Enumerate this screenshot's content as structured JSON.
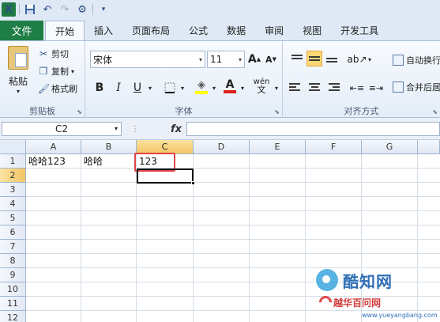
{
  "quick_access": {
    "icons": [
      "excel-app-icon",
      "save-icon",
      "undo-icon",
      "redo-icon",
      "customize-icon"
    ],
    "app_letter": "X"
  },
  "tabs": {
    "file": "文件",
    "items": [
      "开始",
      "插入",
      "页面布局",
      "公式",
      "数据",
      "审阅",
      "视图",
      "开发工具"
    ],
    "active": "开始"
  },
  "ribbon": {
    "clipboard": {
      "label": "剪贴板",
      "paste": "粘贴",
      "cut": "剪切",
      "copy": "复制",
      "format_painter": "格式刷"
    },
    "font": {
      "label": "字体",
      "font_name": "宋体",
      "font_size": "11",
      "grow": "A",
      "shrink": "A",
      "bold": "B",
      "italic": "I",
      "underline": "U",
      "font_color_letter": "A",
      "phonetic": "wén",
      "fill_color": "#ffff00",
      "font_color": "#e0201b"
    },
    "alignment": {
      "label": "对齐方式",
      "wrap_text": "自动换行",
      "merge_center": "合并后居"
    }
  },
  "formula_bar": {
    "name_box": "C2",
    "fx": "fx",
    "dots": "⋮",
    "value": ""
  },
  "sheet": {
    "columns": [
      "A",
      "B",
      "C",
      "D",
      "E",
      "F",
      "G"
    ],
    "rows": [
      "1",
      "2",
      "3",
      "4",
      "5",
      "6",
      "7",
      "8",
      "9",
      "10",
      "11",
      "12"
    ],
    "selected_column": "C",
    "selected_row": "2",
    "cells": {
      "A1": "哈哈123",
      "B1": "哈哈",
      "C1": "123"
    }
  },
  "watermark": {
    "title": "酷知网",
    "subtitle": "越华百问网",
    "url": "www.yueyangbang.com"
  }
}
